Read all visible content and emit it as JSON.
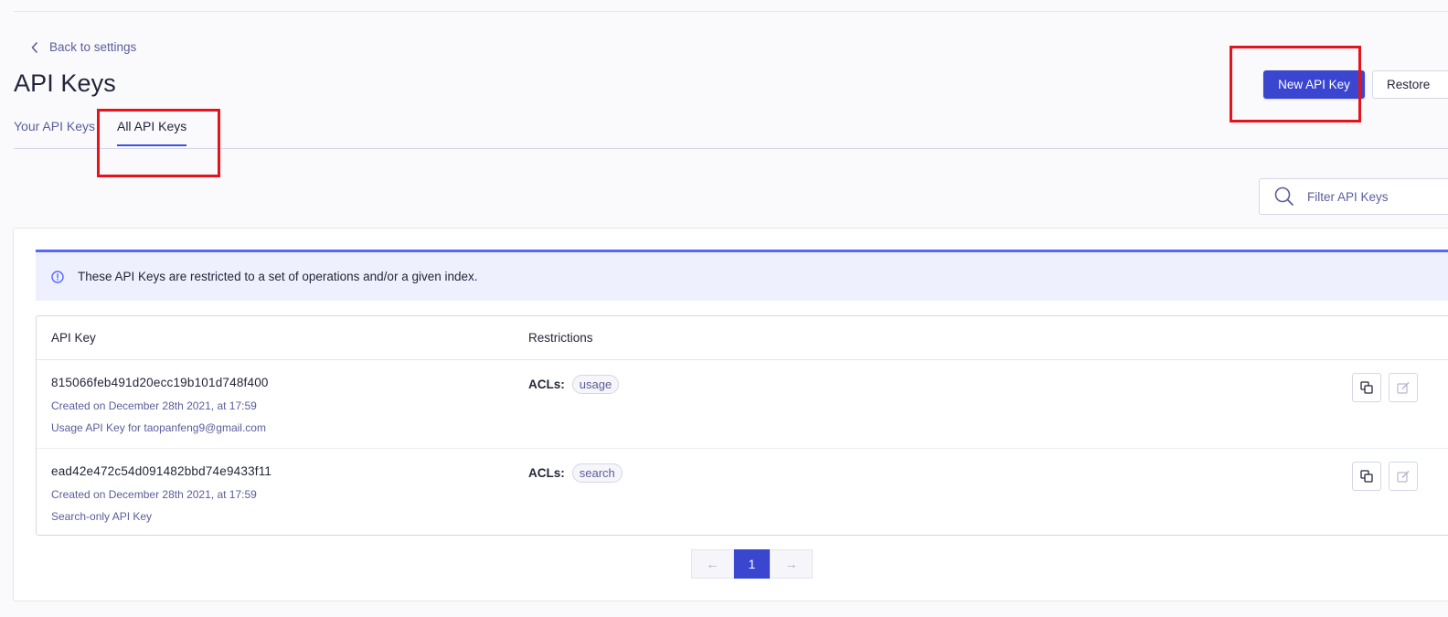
{
  "nav": {
    "back_label": "Back to settings"
  },
  "page": {
    "title": "API Keys"
  },
  "tabs": [
    {
      "label": "Your API Keys",
      "active": false
    },
    {
      "label": "All API Keys",
      "active": true
    }
  ],
  "actions": {
    "new_key_label": "New API Key",
    "restore_label": "Restore"
  },
  "filter": {
    "placeholder": "Filter API Keys",
    "value": ""
  },
  "banner": {
    "text": "These API Keys are restricted to a set of operations and/or a given index."
  },
  "table": {
    "columns": [
      "API Key",
      "Restrictions"
    ],
    "rows": [
      {
        "key": "815066feb491d20ecc19b101d748f400",
        "created": "Created on December 28th 2021, at 17:59",
        "description": "Usage API Key for taopanfeng9@gmail.com",
        "acl_label": "ACLs:",
        "acls": [
          "usage"
        ]
      },
      {
        "key": "ead42e472c54d091482bbd74e9433f11",
        "created": "Created on December 28th 2021, at 17:59",
        "description": "Search-only API Key",
        "acl_label": "ACLs:",
        "acls": [
          "search"
        ]
      }
    ]
  },
  "pagination": {
    "prev": "←",
    "current": "1",
    "next": "→"
  },
  "icons": [
    "chevron-left-icon",
    "search-icon",
    "info-icon",
    "copy-icon",
    "edit-icon"
  ],
  "colors": {
    "accent": "#3a46cf",
    "highlight": "#e5141c",
    "banner_bg": "#eff0fd"
  }
}
